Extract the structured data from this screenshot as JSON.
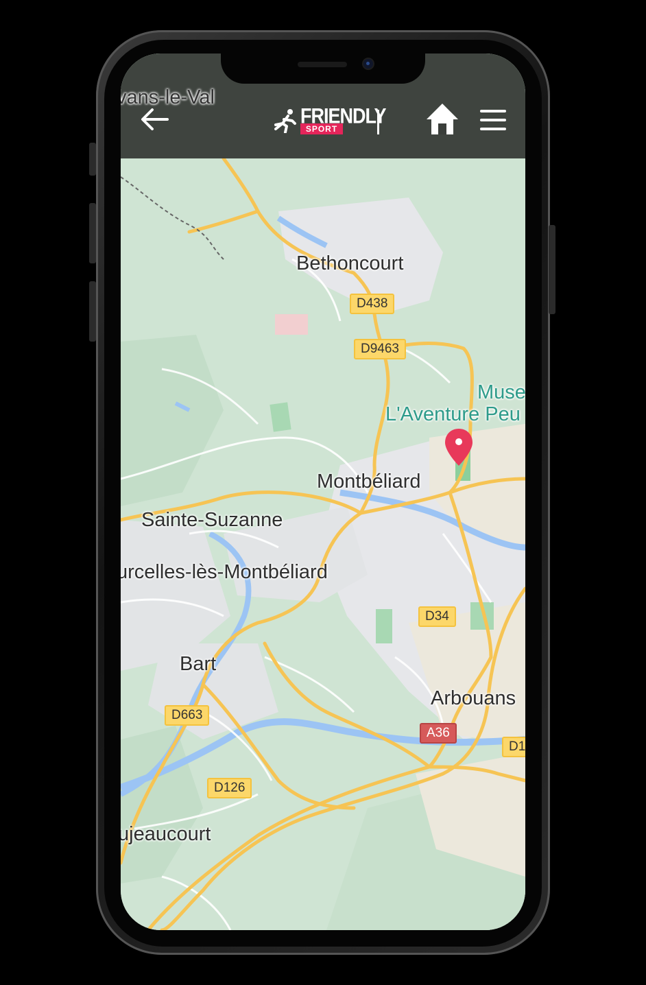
{
  "header": {
    "back_icon": "arrow-left-icon",
    "logo": {
      "main": "FRIENDLY",
      "sub": "SPORT",
      "runner_icon": "runner-icon"
    },
    "home_icon": "home-icon",
    "menu_icon": "hamburger-menu-icon",
    "background": "#343834"
  },
  "map": {
    "places": [
      {
        "name": "vans-le-Val",
        "type": "town"
      },
      {
        "name": "Bethoncourt",
        "type": "town"
      },
      {
        "name": "Muse",
        "type": "poi"
      },
      {
        "name": "L'Aventure Peu",
        "type": "poi"
      },
      {
        "name": "Montbéliard",
        "type": "town"
      },
      {
        "name": "Sainte-Suzanne",
        "type": "town"
      },
      {
        "name": "urcelles-lès-Montbéliard",
        "type": "town"
      },
      {
        "name": "Bart",
        "type": "town"
      },
      {
        "name": "Arbouans",
        "type": "town"
      },
      {
        "name": "ujeaucourt",
        "type": "town"
      }
    ],
    "roads": [
      "D438",
      "D9463",
      "D34",
      "D663",
      "A36",
      "D126",
      "D1"
    ],
    "pin_icon": "map-pin-icon",
    "colors": {
      "land": "#cfe4d3",
      "urban": "#e6e7ea",
      "road": "#f6c454",
      "water": "#9cc4f4",
      "pin": "#e8395a"
    }
  }
}
